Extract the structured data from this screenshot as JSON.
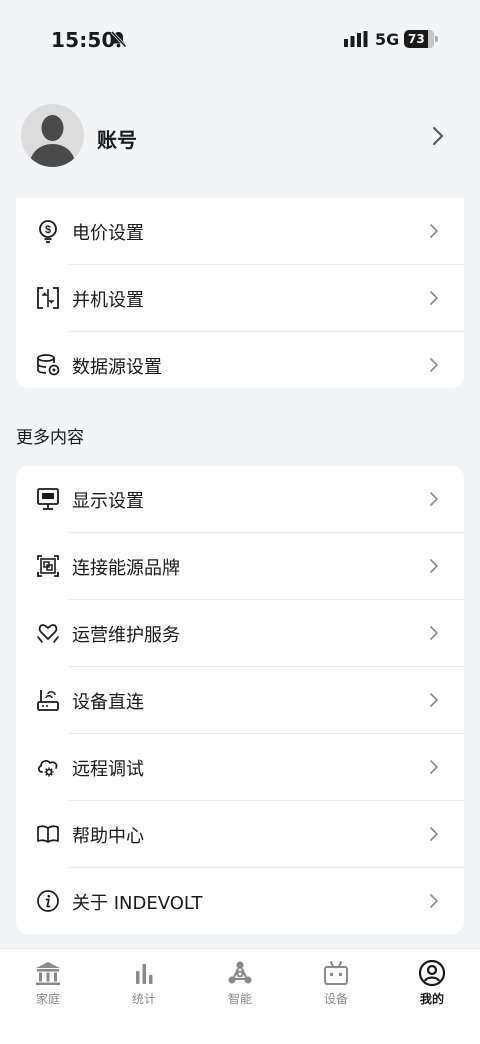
{
  "status_bar": {
    "time": "15:50",
    "network": "5G",
    "battery": "73"
  },
  "account": {
    "name": "账号"
  },
  "settings_group": {
    "items": [
      {
        "label": "电价设置",
        "icon": "price-icon"
      },
      {
        "label": "并机设置",
        "icon": "parallel-icon"
      },
      {
        "label": "数据源设置",
        "icon": "database-icon"
      }
    ]
  },
  "more": {
    "title": "更多内容",
    "items": [
      {
        "label": "显示设置",
        "icon": "monitor-icon"
      },
      {
        "label": "连接能源品牌",
        "icon": "brand-connect-icon"
      },
      {
        "label": "运营维护服务",
        "icon": "heart-hands-icon"
      },
      {
        "label": "设备直连",
        "icon": "router-icon"
      },
      {
        "label": "远程调试",
        "icon": "cloud-gear-icon"
      },
      {
        "label": "帮助中心",
        "icon": "book-icon"
      },
      {
        "label": "关于 INDEVOLT",
        "icon": "info-icon"
      }
    ]
  },
  "tabbar": {
    "tabs": [
      {
        "label": "家庭",
        "icon": "home-icon"
      },
      {
        "label": "统计",
        "icon": "stats-icon"
      },
      {
        "label": "智能",
        "icon": "smart-icon"
      },
      {
        "label": "设备",
        "icon": "device-icon"
      },
      {
        "label": "我的",
        "icon": "profile-icon"
      }
    ],
    "active_tab": "我的"
  },
  "colors": {
    "background": "#f3f4f6",
    "card": "#ffffff",
    "text": "#1a1a1a",
    "muted": "#8a8a8a"
  }
}
